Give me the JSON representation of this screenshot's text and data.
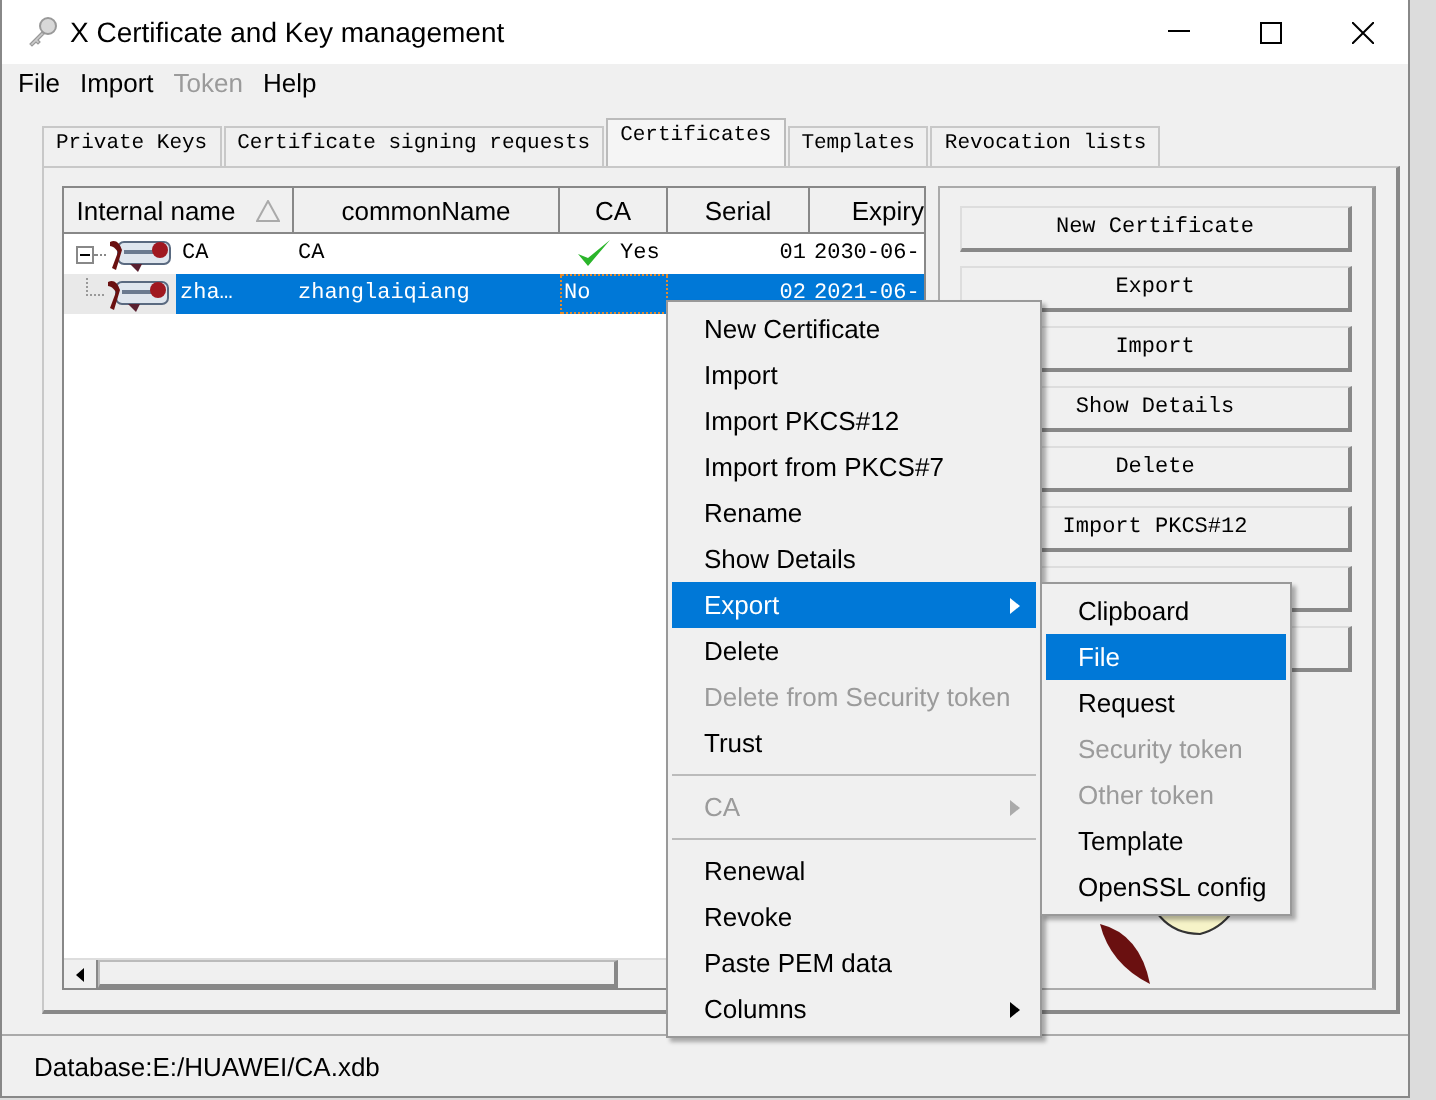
{
  "window": {
    "title": "X Certificate and Key management"
  },
  "menu_bar": [
    {
      "label": "File",
      "disabled": false
    },
    {
      "label": "Import",
      "disabled": false
    },
    {
      "label": "Token",
      "disabled": true
    },
    {
      "label": "Help",
      "disabled": false
    }
  ],
  "tabs": [
    {
      "label": "Private Keys",
      "selected": false
    },
    {
      "label": "Certificate signing requests",
      "selected": false
    },
    {
      "label": "Certificates",
      "selected": true
    },
    {
      "label": "Templates",
      "selected": false
    },
    {
      "label": "Revocation lists",
      "selected": false
    }
  ],
  "table": {
    "columns": [
      {
        "label": "Internal name",
        "sorted": true
      },
      {
        "label": "commonName",
        "sorted": false
      },
      {
        "label": "CA",
        "sorted": false
      },
      {
        "label": "Serial",
        "sorted": false
      },
      {
        "label": "Expiry",
        "sorted": false
      }
    ],
    "rows": [
      {
        "cells": [
          "CA",
          "CA",
          "Yes",
          "01",
          "2030-06-"
        ],
        "ca_check": true,
        "expanded": true,
        "selected": false,
        "children": [
          {
            "cells": [
              "zha…",
              "zhanglaiqiang",
              "No",
              "02",
              "2021-06-"
            ],
            "ca_check": false,
            "selected": true
          }
        ]
      }
    ]
  },
  "buttons": [
    "New Certificate",
    "Export",
    "Import",
    "Show Details",
    "Delete",
    "Import PKCS#12"
  ],
  "context_menu": {
    "items": [
      {
        "kind": "item",
        "label": "New Certificate",
        "disabled": false,
        "selected": false
      },
      {
        "kind": "item",
        "label": "Import",
        "disabled": false,
        "selected": false
      },
      {
        "kind": "item",
        "label": "Import PKCS#12",
        "disabled": false,
        "selected": false
      },
      {
        "kind": "item",
        "label": "Import from PKCS#7",
        "disabled": false,
        "selected": false
      },
      {
        "kind": "item",
        "label": "Rename",
        "disabled": false,
        "selected": false
      },
      {
        "kind": "item",
        "label": "Show Details",
        "disabled": false,
        "selected": false
      },
      {
        "kind": "submenu",
        "label": "Export",
        "disabled": false,
        "selected": true
      },
      {
        "kind": "item",
        "label": "Delete",
        "disabled": false,
        "selected": false
      },
      {
        "kind": "item",
        "label": "Delete from Security token",
        "disabled": true,
        "selected": false
      },
      {
        "kind": "item",
        "label": "Trust",
        "disabled": false,
        "selected": false
      },
      {
        "kind": "separator"
      },
      {
        "kind": "submenu",
        "label": "CA",
        "disabled": true,
        "selected": false
      },
      {
        "kind": "separator"
      },
      {
        "kind": "item",
        "label": "Renewal",
        "disabled": false,
        "selected": false
      },
      {
        "kind": "item",
        "label": "Revoke",
        "disabled": false,
        "selected": false
      },
      {
        "kind": "item",
        "label": "Paste PEM data",
        "disabled": false,
        "selected": false
      },
      {
        "kind": "submenu",
        "label": "Columns",
        "disabled": false,
        "selected": false
      }
    ]
  },
  "submenu": {
    "items": [
      {
        "label": "Clipboard",
        "disabled": false,
        "selected": false
      },
      {
        "label": "File",
        "disabled": false,
        "selected": true
      },
      {
        "label": "Request",
        "disabled": false,
        "selected": false
      },
      {
        "label": "Security token",
        "disabled": true,
        "selected": false
      },
      {
        "label": "Other token",
        "disabled": true,
        "selected": false
      },
      {
        "label": "Template",
        "disabled": false,
        "selected": false
      },
      {
        "label": "OpenSSL config",
        "disabled": false,
        "selected": false
      }
    ]
  },
  "status_bar": {
    "text": "Database:E:/HUAWEI/CA.xdb"
  }
}
